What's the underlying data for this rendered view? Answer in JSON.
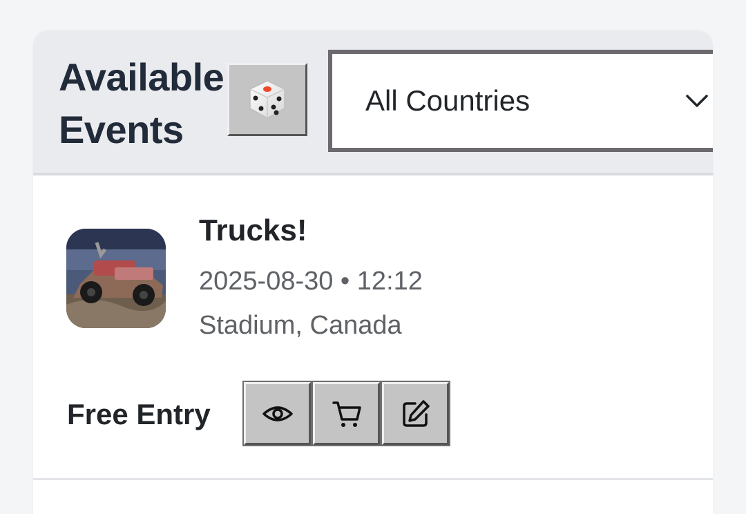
{
  "header": {
    "title": "Available Events",
    "random_button_icon": "dice-icon",
    "country_select": {
      "selected": "All Countries",
      "icon": "chevron-down-icon"
    }
  },
  "event": {
    "title": "Trucks!",
    "datetime": "2025-08-30 • 12:12",
    "location": "Stadium, Canada",
    "price": "Free Entry",
    "thumbnail": "monster-truck-image",
    "actions": [
      {
        "icon": "eye-icon"
      },
      {
        "icon": "cart-icon"
      },
      {
        "icon": "edit-icon"
      }
    ]
  },
  "colors": {
    "page_bg": "#f4f5f7",
    "header_bg": "#e9ebee",
    "title": "#212b3a",
    "muted_text": "#5e6266",
    "button_face": "#c4c4c4",
    "dice_pip_accent": "#f04a2a"
  }
}
